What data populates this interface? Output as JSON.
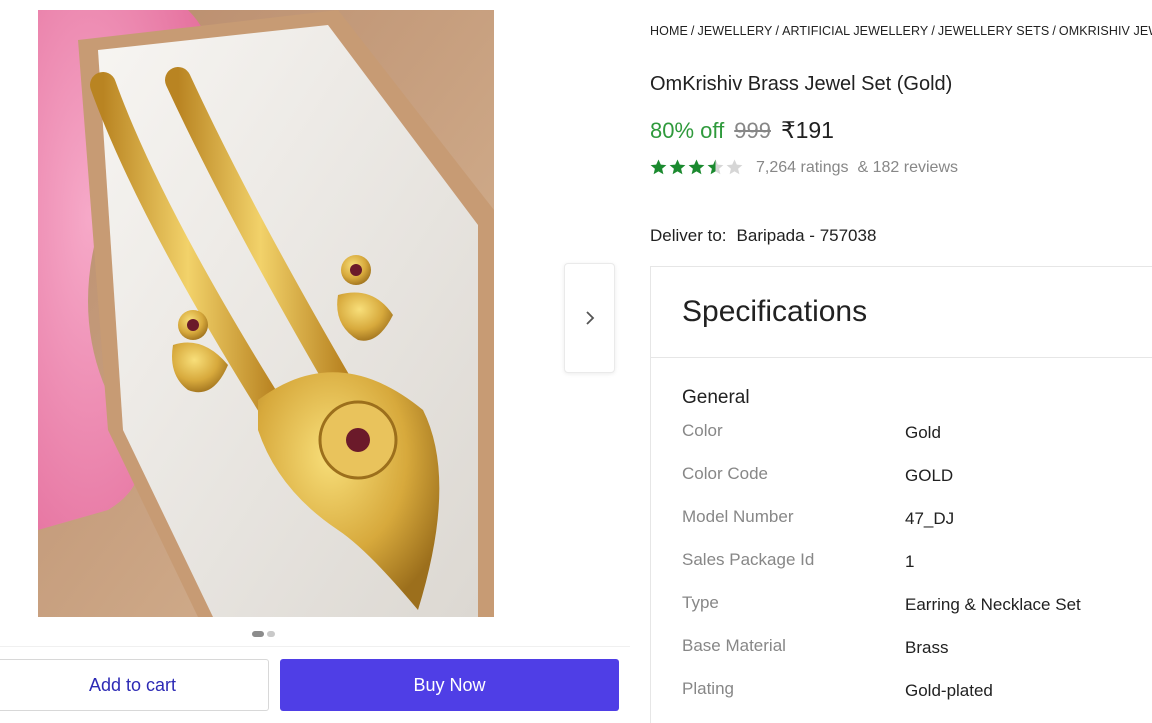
{
  "breadcrumb": [
    "HOME",
    "JEWELLERY",
    "ARTIFICIAL JEWELLERY",
    "JEWELLERY SETS",
    "OMKRISHIV JEW"
  ],
  "product": {
    "title": "OmKrishiv Brass Jewel Set (Gold)",
    "discount": "80% off",
    "mrp": "999",
    "price": "₹191",
    "rating_value": 3.5,
    "ratings_count": "7,264 ratings",
    "reviews_count": "& 182 reviews"
  },
  "delivery": {
    "label": "Deliver to:",
    "location": "Baripada - 757038"
  },
  "carousel": {
    "dots": 2,
    "active_index": 0,
    "next_icon": "chevron-right-icon"
  },
  "actions": {
    "add_to_cart": "Add to cart",
    "buy_now": "Buy Now"
  },
  "specifications": {
    "title": "Specifications",
    "groups": [
      {
        "name": "General",
        "rows": [
          {
            "key": "Color",
            "value": "Gold"
          },
          {
            "key": "Color Code",
            "value": "GOLD"
          },
          {
            "key": "Model Number",
            "value": "47_DJ"
          },
          {
            "key": "Sales Package Id",
            "value": "1"
          },
          {
            "key": "Type",
            "value": "Earring & Necklace Set"
          },
          {
            "key": "Base Material",
            "value": "Brass"
          },
          {
            "key": "Plating",
            "value": "Gold-plated"
          }
        ]
      }
    ]
  },
  "colors": {
    "discount_green": "#2f9a3c",
    "star_green": "#1b8a2f",
    "buy_button": "#4f3ee6",
    "cart_text": "#2d2ab5"
  }
}
